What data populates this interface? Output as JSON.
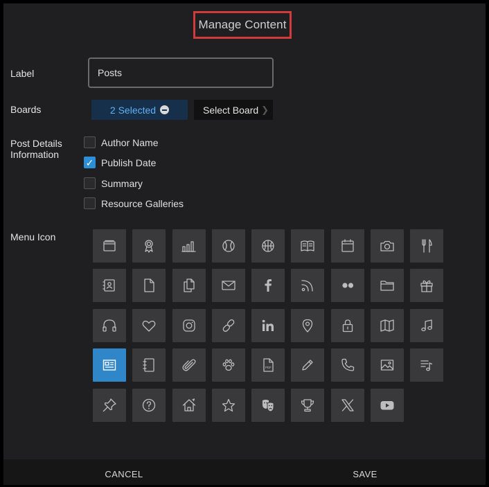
{
  "dialog": {
    "title": "Manage Content"
  },
  "label_field": {
    "label": "Label",
    "value": "Posts"
  },
  "boards": {
    "label": "Boards",
    "selected_text": "2 Selected",
    "select_button": "Select Board"
  },
  "post_details": {
    "label_line1": "Post Details",
    "label_line2": "Information",
    "options": [
      {
        "label": "Author Name",
        "checked": false
      },
      {
        "label": "Publish Date",
        "checked": true
      },
      {
        "label": "Summary",
        "checked": false
      },
      {
        "label": "Resource Galleries",
        "checked": false
      }
    ]
  },
  "menu_icon": {
    "label": "Menu Icon",
    "selected": "news-icon",
    "icons": [
      "window-icon",
      "award-icon",
      "bar-chart-icon",
      "baseball-icon",
      "basketball-icon",
      "book-icon",
      "calendar-icon",
      "camera-icon",
      "utensils-icon",
      "contact-card-icon",
      "document-icon",
      "documents-icon",
      "envelope-icon",
      "facebook-icon",
      "rss-icon",
      "flickr-icon",
      "folder-icon",
      "gift-icon",
      "headphones-icon",
      "heart-icon",
      "instagram-icon",
      "link-icon",
      "linkedin-icon",
      "map-pin-icon",
      "lock-icon",
      "map-icon",
      "music-note-icon",
      "news-icon",
      "notebook-icon",
      "paperclip-icon",
      "paw-icon",
      "pdf-icon",
      "pencil-icon",
      "phone-icon",
      "image-icon",
      "playlist-icon",
      "pushpin-icon",
      "question-icon",
      "home-icon",
      "star-icon",
      "theater-masks-icon",
      "trophy-icon",
      "x-logo-icon",
      "youtube-icon"
    ]
  },
  "footer": {
    "cancel": "CANCEL",
    "save": "SAVE"
  },
  "colors": {
    "accent": "#2f87c9",
    "highlight_border": "#d23b3b",
    "selected_pill_bg": "#16304c"
  }
}
